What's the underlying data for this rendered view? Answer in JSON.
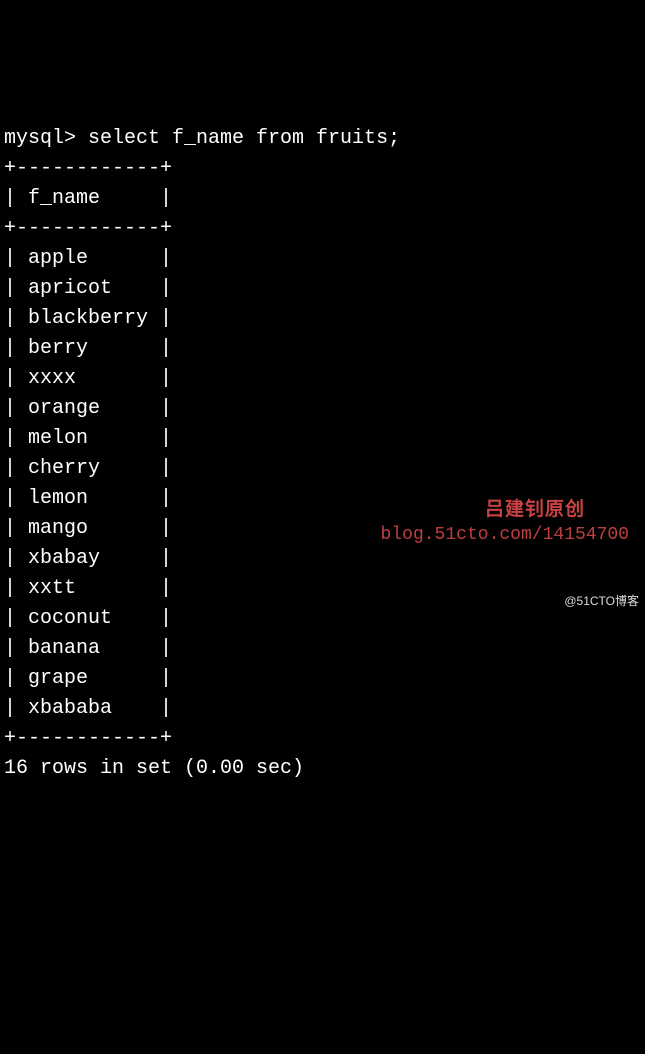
{
  "prompt": "mysql> ",
  "query": "select f_name from fruits;",
  "table": {
    "border": "+------------+",
    "header": "| f_name     |",
    "rows": [
      "| apple      |",
      "| apricot    |",
      "| blackberry |",
      "| berry      |",
      "| xxxx       |",
      "| orange     |",
      "| melon      |",
      "| cherry     |",
      "| lemon      |",
      "| mango      |",
      "| xbabay     |",
      "| xxtt       |",
      "| coconut    |",
      "| banana     |",
      "| grape      |",
      "| xbababa    |"
    ]
  },
  "summary": "16 rows in set (0.00 sec)",
  "watermark": {
    "label_cn": "吕建钊原创",
    "url": "blog.51cto.com/14154700",
    "credit": "@51CTO博客"
  }
}
